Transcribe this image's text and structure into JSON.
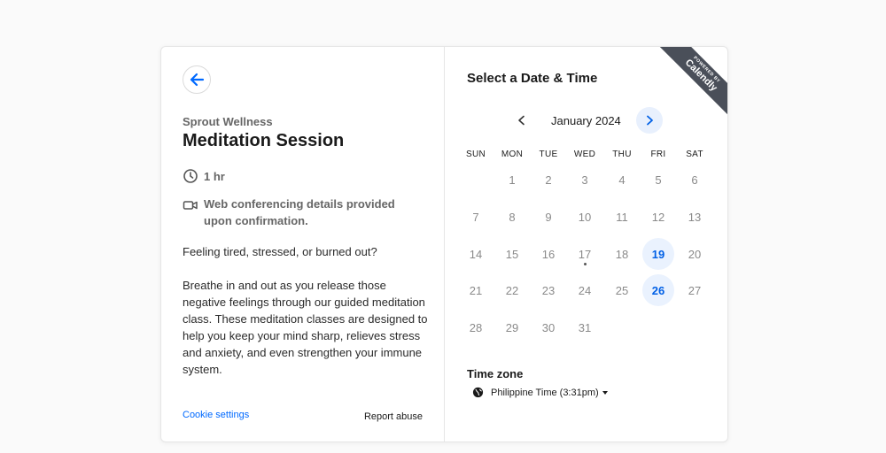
{
  "event": {
    "organizer": "Sprout Wellness",
    "title": "Meditation Session",
    "duration": "1 hr",
    "conferencing": "Web conferencing details provided upon confirmation.",
    "description": [
      "Feeling tired, stressed, or burned out?",
      "Breathe in and out as you release those negative feelings through our guided meditation class. These meditation classes are designed to help you keep your mind sharp, relieves stress and anxiety, and even strengthen your immune system."
    ]
  },
  "footer": {
    "cookie_settings": "Cookie settings",
    "report_abuse": "Report abuse"
  },
  "scheduler": {
    "heading": "Select a Date & Time",
    "month_label": "January 2024",
    "weekdays": [
      "SUN",
      "MON",
      "TUE",
      "WED",
      "THU",
      "FRI",
      "SAT"
    ],
    "days": [
      [
        "",
        "1",
        "2",
        "3",
        "4",
        "5",
        "6"
      ],
      [
        "7",
        "8",
        "9",
        "10",
        "11",
        "12",
        "13"
      ],
      [
        "14",
        "15",
        "16",
        "17",
        "18",
        "19",
        "20"
      ],
      [
        "21",
        "22",
        "23",
        "24",
        "25",
        "26",
        "27"
      ],
      [
        "28",
        "29",
        "30",
        "31",
        "",
        "",
        ""
      ]
    ],
    "available_days": [
      "19",
      "26"
    ],
    "today": "17",
    "timezone_label": "Time zone",
    "timezone_value": "Philippine Time (3:31pm)"
  },
  "badge": {
    "line1": "POWERED BY",
    "line2": "Calendly"
  },
  "colors": {
    "accent": "#0069ff",
    "available_bg": "#eaf2fe",
    "ribbon": "#4a4f59"
  },
  "icons": {
    "back": "arrow-left-icon",
    "duration": "clock-icon",
    "conferencing": "video-camera-icon",
    "prev": "chevron-left-icon",
    "next": "chevron-right-icon",
    "timezone": "globe-icon"
  }
}
